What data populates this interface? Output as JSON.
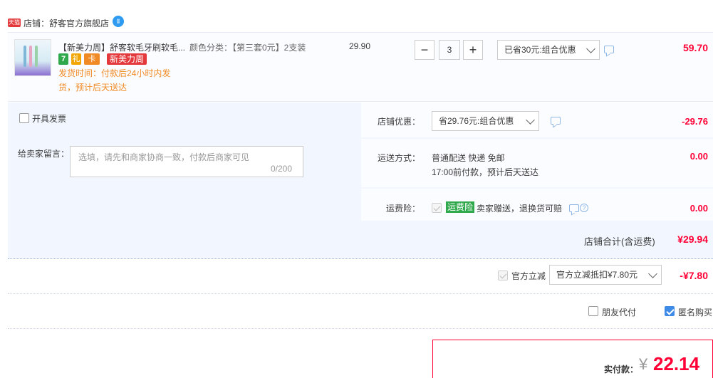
{
  "shop": {
    "badge": "天猫",
    "label": "店铺：舒客官方旗舰店",
    "ww_icon": "wangwang-chat-icon"
  },
  "item": {
    "title": "【新美力周】舒客软毛牙刷软毛...",
    "spec": "颜色分类：【第三套0元】2支装",
    "tags": [
      "7",
      "礼",
      "卡"
    ],
    "promo_tag": "新美力周",
    "ship_line1": "发货时间：付款后24小时内发",
    "ship_line2": "货，预计后天送达",
    "unit_price": "29.90",
    "qty_minus": "−",
    "qty_value": "3",
    "qty_plus": "+",
    "discount_select": "已省30元:组合优惠",
    "subtotal": "59.70"
  },
  "invoice": {
    "label": "开具发票"
  },
  "message": {
    "label": "给卖家留言：",
    "placeholder": "选填，请先和商家协商一致，付款后商家可见",
    "counter": "0/200"
  },
  "shop_discount": {
    "label": "店铺优惠：",
    "select": "省29.76元:组合优惠",
    "amount": "-29.76"
  },
  "shipping": {
    "label": "运送方式：",
    "line1": "普通配送 快递 免邮",
    "line2": "17:00前付款，预计后天送达",
    "amount": "0.00"
  },
  "insurance": {
    "label": "运费险：",
    "tag": "运费险",
    "text": "卖家赠送，退换货可赔",
    "amount": "0.00"
  },
  "shop_total": {
    "label": "店铺合计(含运费)",
    "amount": "¥29.94"
  },
  "official": {
    "label": "官方立减",
    "select": "官方立减抵扣¥7.80元",
    "amount": "-¥7.80"
  },
  "options": {
    "friend_pay": "朋友代付",
    "anonymous": "匿名购买"
  },
  "payable": {
    "label": "实付款：",
    "currency": "¥",
    "amount": "22.14"
  },
  "colors": {
    "price_red": "#ff0036",
    "option_bg": "#f2f7ff",
    "accent_blue": "#3d8be6",
    "ship_orange": "#f08a24",
    "insurance_green": "#2fa94b"
  }
}
